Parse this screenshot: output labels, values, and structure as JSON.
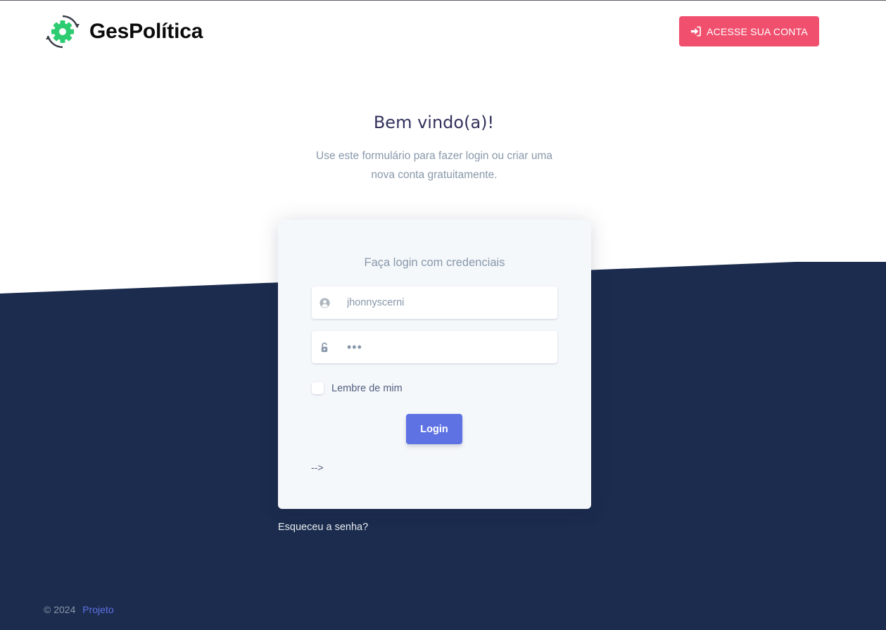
{
  "brand": {
    "name": "GesPolítica",
    "logo_icon": "gear-refresh-icon",
    "logo_color": "#2ecc71"
  },
  "header": {
    "account_button": {
      "label": "ACESSE SUA CONTA",
      "icon": "sign-in-icon",
      "color": "#f0506e"
    }
  },
  "hero": {
    "title": "Bem vindo(a)!",
    "lead_line1": "Use este formulário para fazer login ou criar uma",
    "lead_line2": "nova conta gratuitamente."
  },
  "login_card": {
    "title": "Faça login com credenciais",
    "username_value": "jhonnyscerni",
    "username_icon": "user-circle-icon",
    "password_value": "•••",
    "password_icon": "lock-open-icon",
    "remember_label": "Lembre de mim",
    "remember_checked": false,
    "submit_label": "Login",
    "submit_color": "#5e72e4",
    "stray_text": "-->"
  },
  "forgot_password": "Esqueceu a senha?",
  "footer": {
    "copyright": "© 2024",
    "link_label": "Projeto"
  },
  "colors": {
    "dark_section": "#1b2c4e",
    "card_background": "#f5f8fb"
  }
}
